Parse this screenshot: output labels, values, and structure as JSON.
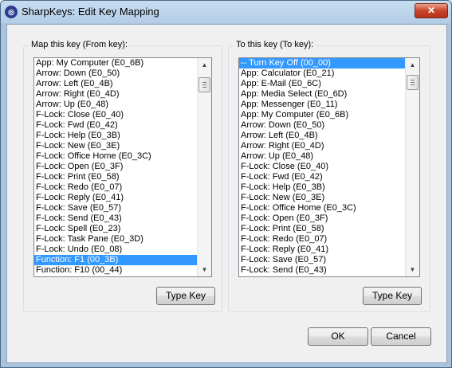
{
  "window": {
    "title": "SharpKeys: Edit Key Mapping",
    "close_glyph": "✕"
  },
  "from_group": {
    "label": "Map this key (From key):",
    "items": [
      "App: My Computer (E0_6B)",
      "Arrow: Down (E0_50)",
      "Arrow: Left (E0_4B)",
      "Arrow: Right (E0_4D)",
      "Arrow: Up (E0_48)",
      "F-Lock: Close (E0_40)",
      "F-Lock: Fwd (E0_42)",
      "F-Lock: Help (E0_3B)",
      "F-Lock: New (E0_3E)",
      "F-Lock: Office Home (E0_3C)",
      "F-Lock: Open (E0_3F)",
      "F-Lock: Print (E0_58)",
      "F-Lock: Redo (E0_07)",
      "F-Lock: Reply (E0_41)",
      "F-Lock: Save (E0_57)",
      "F-Lock: Send (E0_43)",
      "F-Lock: Spell (E0_23)",
      "F-Lock: Task Pane (E0_3D)",
      "F-Lock: Undo (E0_08)",
      "Function: F1 (00_3B)",
      "Function: F10 (00_44)"
    ],
    "selected_index": 19,
    "button_label": "Type Key"
  },
  "to_group": {
    "label": "To this key (To key):",
    "items": [
      "-- Turn Key Off (00_00)",
      "App: Calculator (E0_21)",
      "App: E-Mail (E0_6C)",
      "App: Media Select (E0_6D)",
      "App: Messenger (E0_11)",
      "App: My Computer (E0_6B)",
      "Arrow: Down (E0_50)",
      "Arrow: Left (E0_4B)",
      "Arrow: Right (E0_4D)",
      "Arrow: Up (E0_48)",
      "F-Lock: Close (E0_40)",
      "F-Lock: Fwd (E0_42)",
      "F-Lock: Help (E0_3B)",
      "F-Lock: New (E0_3E)",
      "F-Lock: Office Home (E0_3C)",
      "F-Lock: Open (E0_3F)",
      "F-Lock: Print (E0_58)",
      "F-Lock: Redo (E0_07)",
      "F-Lock: Reply (E0_41)",
      "F-Lock: Save (E0_57)",
      "F-Lock: Send (E0_43)"
    ],
    "selected_index": 0,
    "button_label": "Type Key"
  },
  "footer": {
    "ok_label": "OK",
    "cancel_label": "Cancel"
  },
  "colors": {
    "selection": "#3399ff",
    "title_gradient_top": "#c6dcf0"
  }
}
